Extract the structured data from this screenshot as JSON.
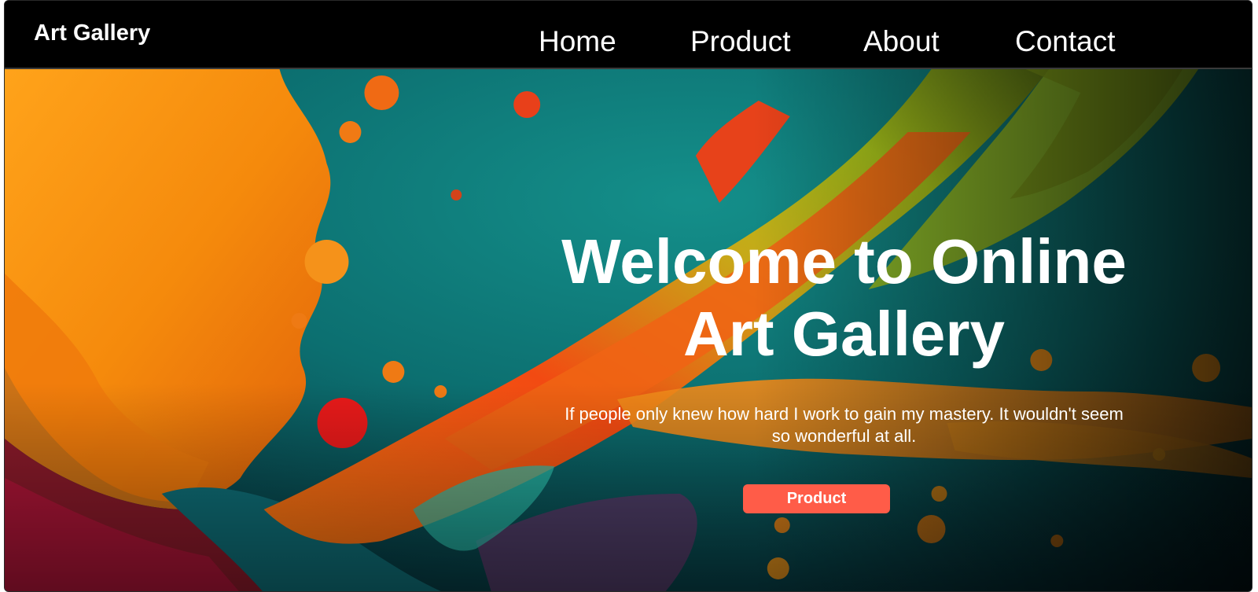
{
  "nav": {
    "brand": "Art Gallery",
    "links": [
      {
        "label": "Home"
      },
      {
        "label": "Product"
      },
      {
        "label": "About"
      },
      {
        "label": "Contact"
      }
    ]
  },
  "hero": {
    "title": "Welcome to Online Art Gallery",
    "subtitle": "If people only knew how hard I work to gain my mastery. It wouldn't seem so wonderful at all.",
    "button_label": "Product",
    "image_name": "abstract-paint-splash-image"
  },
  "colors": {
    "nav_background": "#000000",
    "nav_text": "#ffffff",
    "hero_text": "#ffffff",
    "button_background": "#ff5c48",
    "button_text": "#ffffff"
  }
}
